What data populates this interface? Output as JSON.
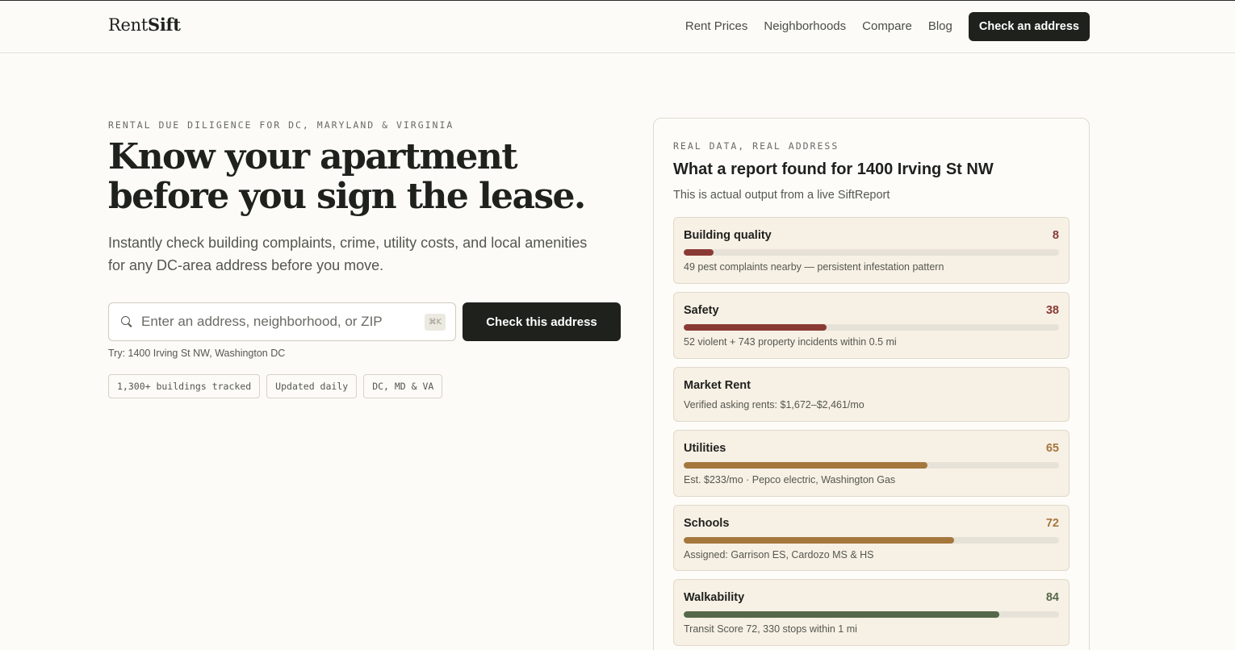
{
  "header": {
    "logo_regular": "Rent",
    "logo_bold": "Sift",
    "nav": [
      "Rent Prices",
      "Neighborhoods",
      "Compare",
      "Blog"
    ],
    "cta": "Check an address"
  },
  "hero": {
    "eyebrow": "RENTAL DUE DILIGENCE FOR DC, MARYLAND & VIRGINIA",
    "title": "Know your apartment before you sign the lease.",
    "subtitle": "Instantly check building complaints, crime, utility costs, and local amenities for any DC-area address before you move.",
    "search_placeholder": "Enter an address, neighborhood, or ZIP",
    "search_shortcut": "⌘K",
    "search_button": "Check this address",
    "try_text": "Try: 1400 Irving St NW, Washington DC",
    "tags": [
      "1,300+ buildings tracked",
      "Updated daily",
      "DC, MD & VA"
    ]
  },
  "report": {
    "eyebrow": "REAL DATA, REAL ADDRESS",
    "title": "What a report found for 1400 Irving St NW",
    "subtitle": "This is actual output from a live SiftReport",
    "metrics": [
      {
        "name": "Building quality",
        "score": "8",
        "progress": 0.08,
        "color": "#8a3a34",
        "note": "49 pest complaints nearby — persistent infestation pattern"
      },
      {
        "name": "Safety",
        "score": "38",
        "progress": 0.38,
        "color": "#8a3a34",
        "note": "52 violent + 743 property incidents within 0.5 mi"
      },
      {
        "name": "Market Rent",
        "score": "",
        "progress": null,
        "color": "",
        "note": "Verified asking rents: $1,672–$2,461/mo"
      },
      {
        "name": "Utilities",
        "score": "65",
        "progress": 0.65,
        "color": "#a5773d",
        "note": "Est. $233/mo · Pepco electric, Washington Gas"
      },
      {
        "name": "Schools",
        "score": "72",
        "progress": 0.72,
        "color": "#a5773d",
        "note": "Assigned: Garrison ES, Cardozo MS & HS"
      },
      {
        "name": "Walkability",
        "score": "84",
        "progress": 0.84,
        "color": "#55694a",
        "note": "Transit Score 72, 330 stops within 1 mi"
      }
    ]
  }
}
